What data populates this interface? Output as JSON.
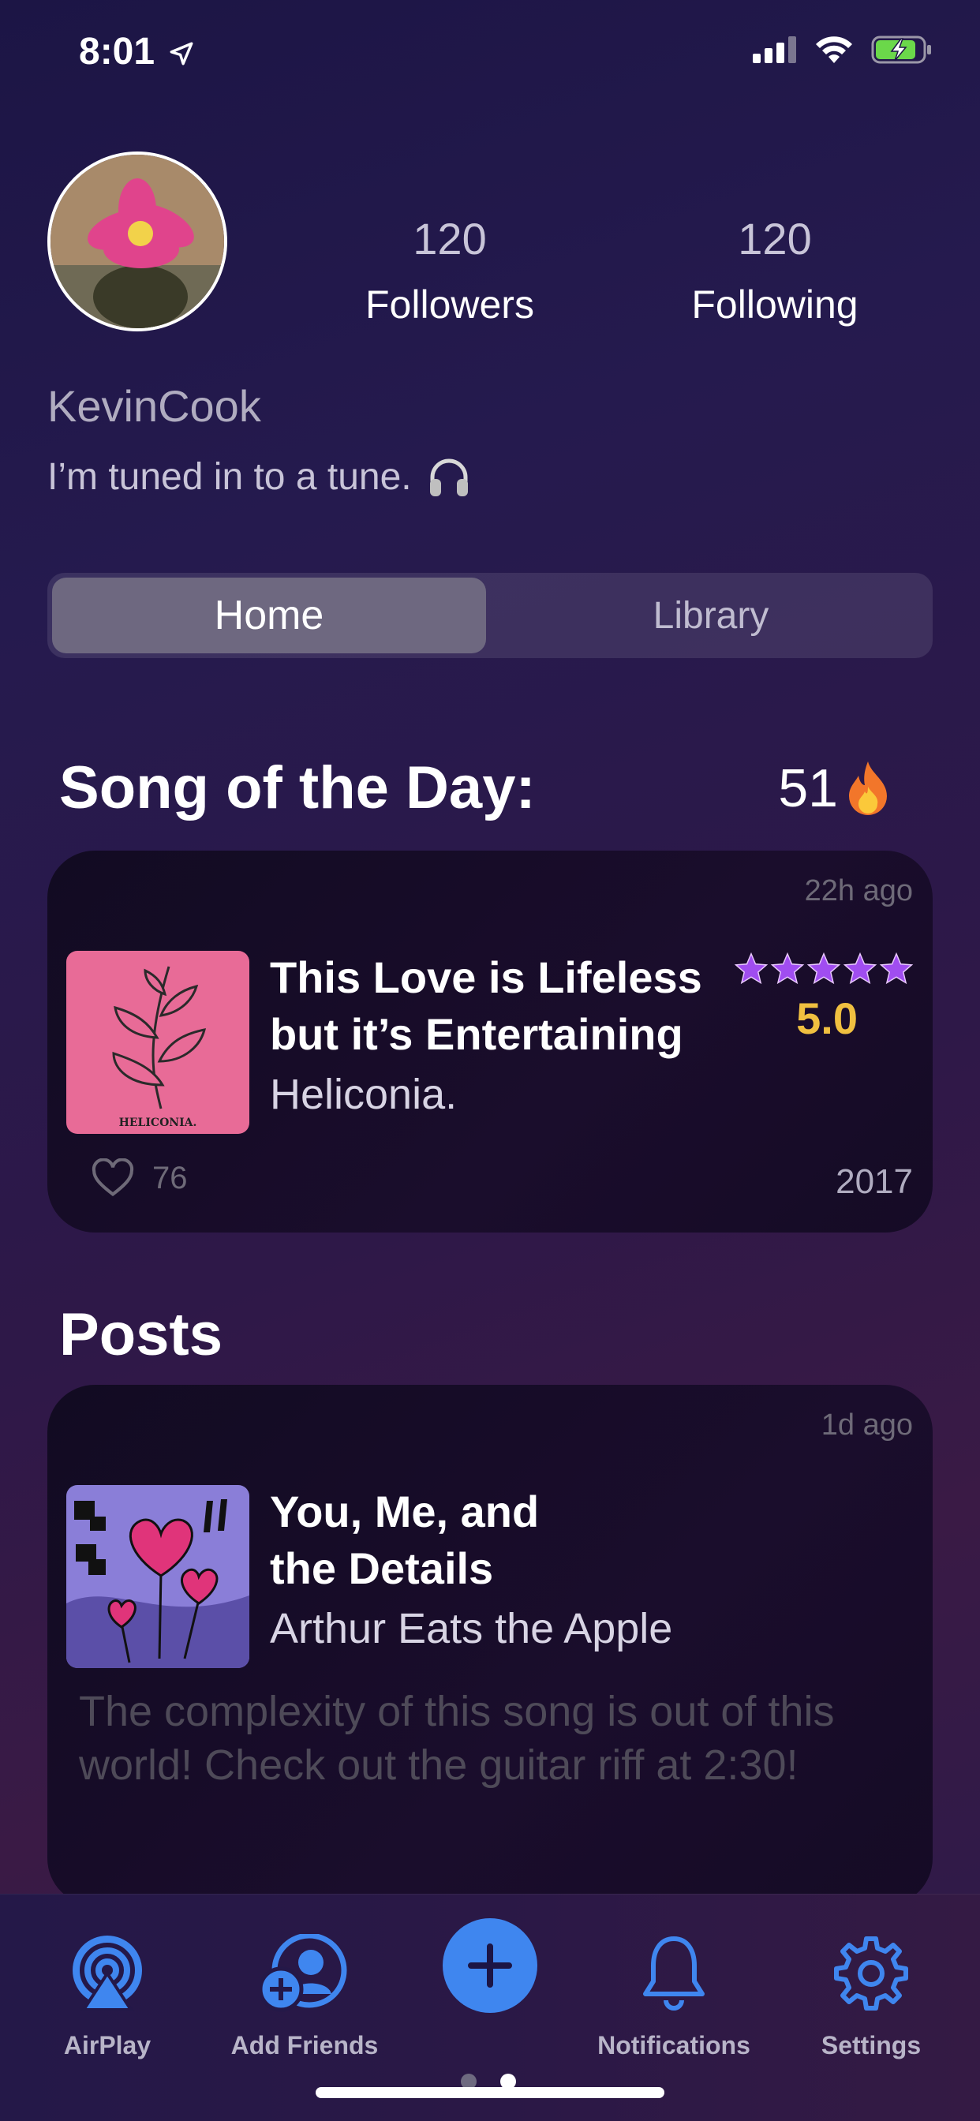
{
  "status_bar": {
    "time": "8:01"
  },
  "profile": {
    "followers_count": "120",
    "followers_label": "Followers",
    "following_count": "120",
    "following_label": "Following",
    "username": "KevinCook",
    "bio": "I’m tuned in to a tune."
  },
  "segments": {
    "home": "Home",
    "library": "Library"
  },
  "song_of_day": {
    "title": "Song of the Day:",
    "streak": "51",
    "time_ago": "22h ago",
    "song_line1": "This Love is Lifeless",
    "song_line2": "but it’s Entertaining",
    "artist": "Heliconia.",
    "rating": "5.0",
    "stars": 5,
    "likes": "76",
    "year": "2017",
    "art_caption": "HELICONIA."
  },
  "posts": {
    "title": "Posts",
    "items": [
      {
        "time_ago": "1d ago",
        "song_line1": "You, Me, and",
        "song_line2": "the Details",
        "artist": "Arthur Eats the Apple",
        "body": "The complexity of this song is out of this world! Check out the guitar riff at 2:30!"
      }
    ]
  },
  "tabbar": {
    "airplay": "AirPlay",
    "add_friends": "Add Friends",
    "notifications": "Notifications",
    "settings": "Settings"
  },
  "colors": {
    "accent_blue": "#3f86ef",
    "rating_gold": "#f0c040",
    "star_purple": "#a04df0"
  }
}
